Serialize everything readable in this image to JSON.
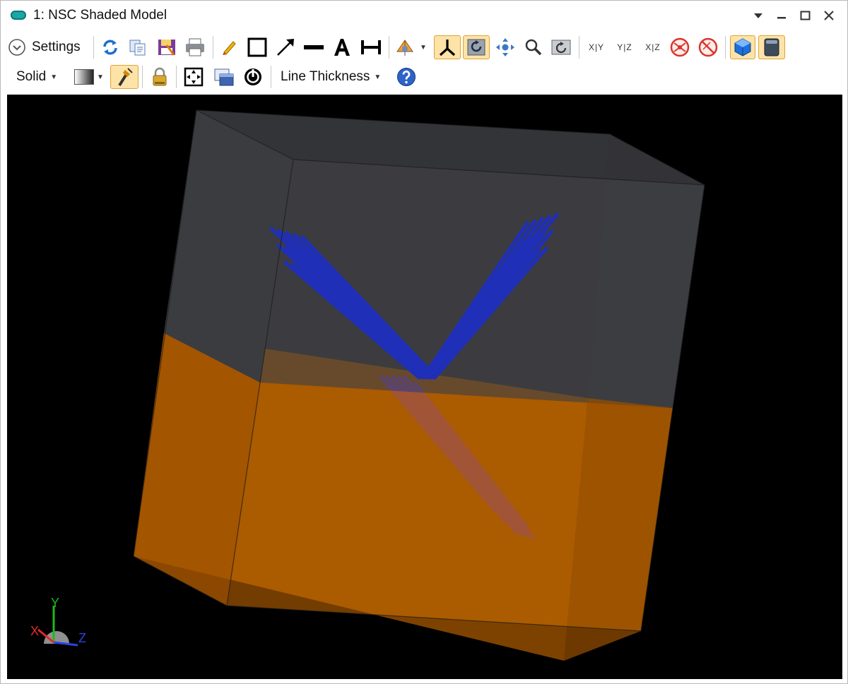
{
  "window": {
    "title": "1: NSC Shaded Model",
    "controls": [
      "dropdown",
      "minimize",
      "maximize",
      "close"
    ]
  },
  "toolbar": {
    "settings_label": "Settings",
    "render_mode_label": "Solid",
    "line_thickness_label": "Line Thickness",
    "view_xy_label": "X|Y",
    "view_yz_label": "Y|Z",
    "view_xz_label": "X|Z"
  },
  "axes": {
    "x_label": "X",
    "y_label": "Y",
    "z_label": "Z"
  },
  "colors": {
    "box_top": "#3a3b3f",
    "box_bottom": "#b85e00",
    "rays_upper": "#1f2fb8",
    "rays_lower": "#6b3aa8",
    "toggle_active": "#fde3a7"
  }
}
